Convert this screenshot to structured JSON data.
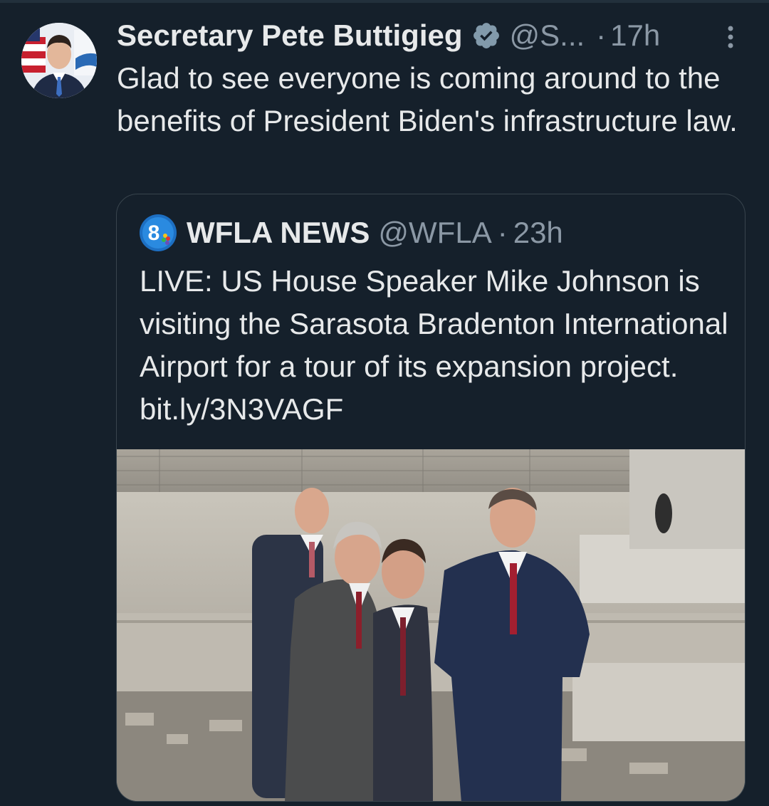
{
  "tweet": {
    "display_name": "Secretary Pete Buttigieg",
    "handle": "@S...",
    "separator": "·",
    "time": "17h",
    "text": "Glad to see everyone is coming around to the benefits of President Biden's infrastructure law.",
    "icons": {
      "verified": "verified-badge-icon",
      "more": "more-options-icon",
      "avatar": "profile-avatar"
    }
  },
  "quoted_tweet": {
    "display_name": "WFLA NEWS",
    "handle": "@WFLA",
    "separator": "·",
    "time": "23h",
    "text": "LIVE: US House Speaker Mike Johnson is visiting the Sarasota Bradenton International Airport for a tour of its expansion project. bit.ly/3N3VAGF",
    "logo_icon": "wfla-8-logo-icon",
    "media_description_icon": "airport-construction-photo"
  },
  "colors": {
    "background": "#15202b",
    "primary_text": "#e7e9ea",
    "secondary_text": "#8b98a5",
    "border": "#38444d",
    "accent": "#1d9bf0"
  }
}
